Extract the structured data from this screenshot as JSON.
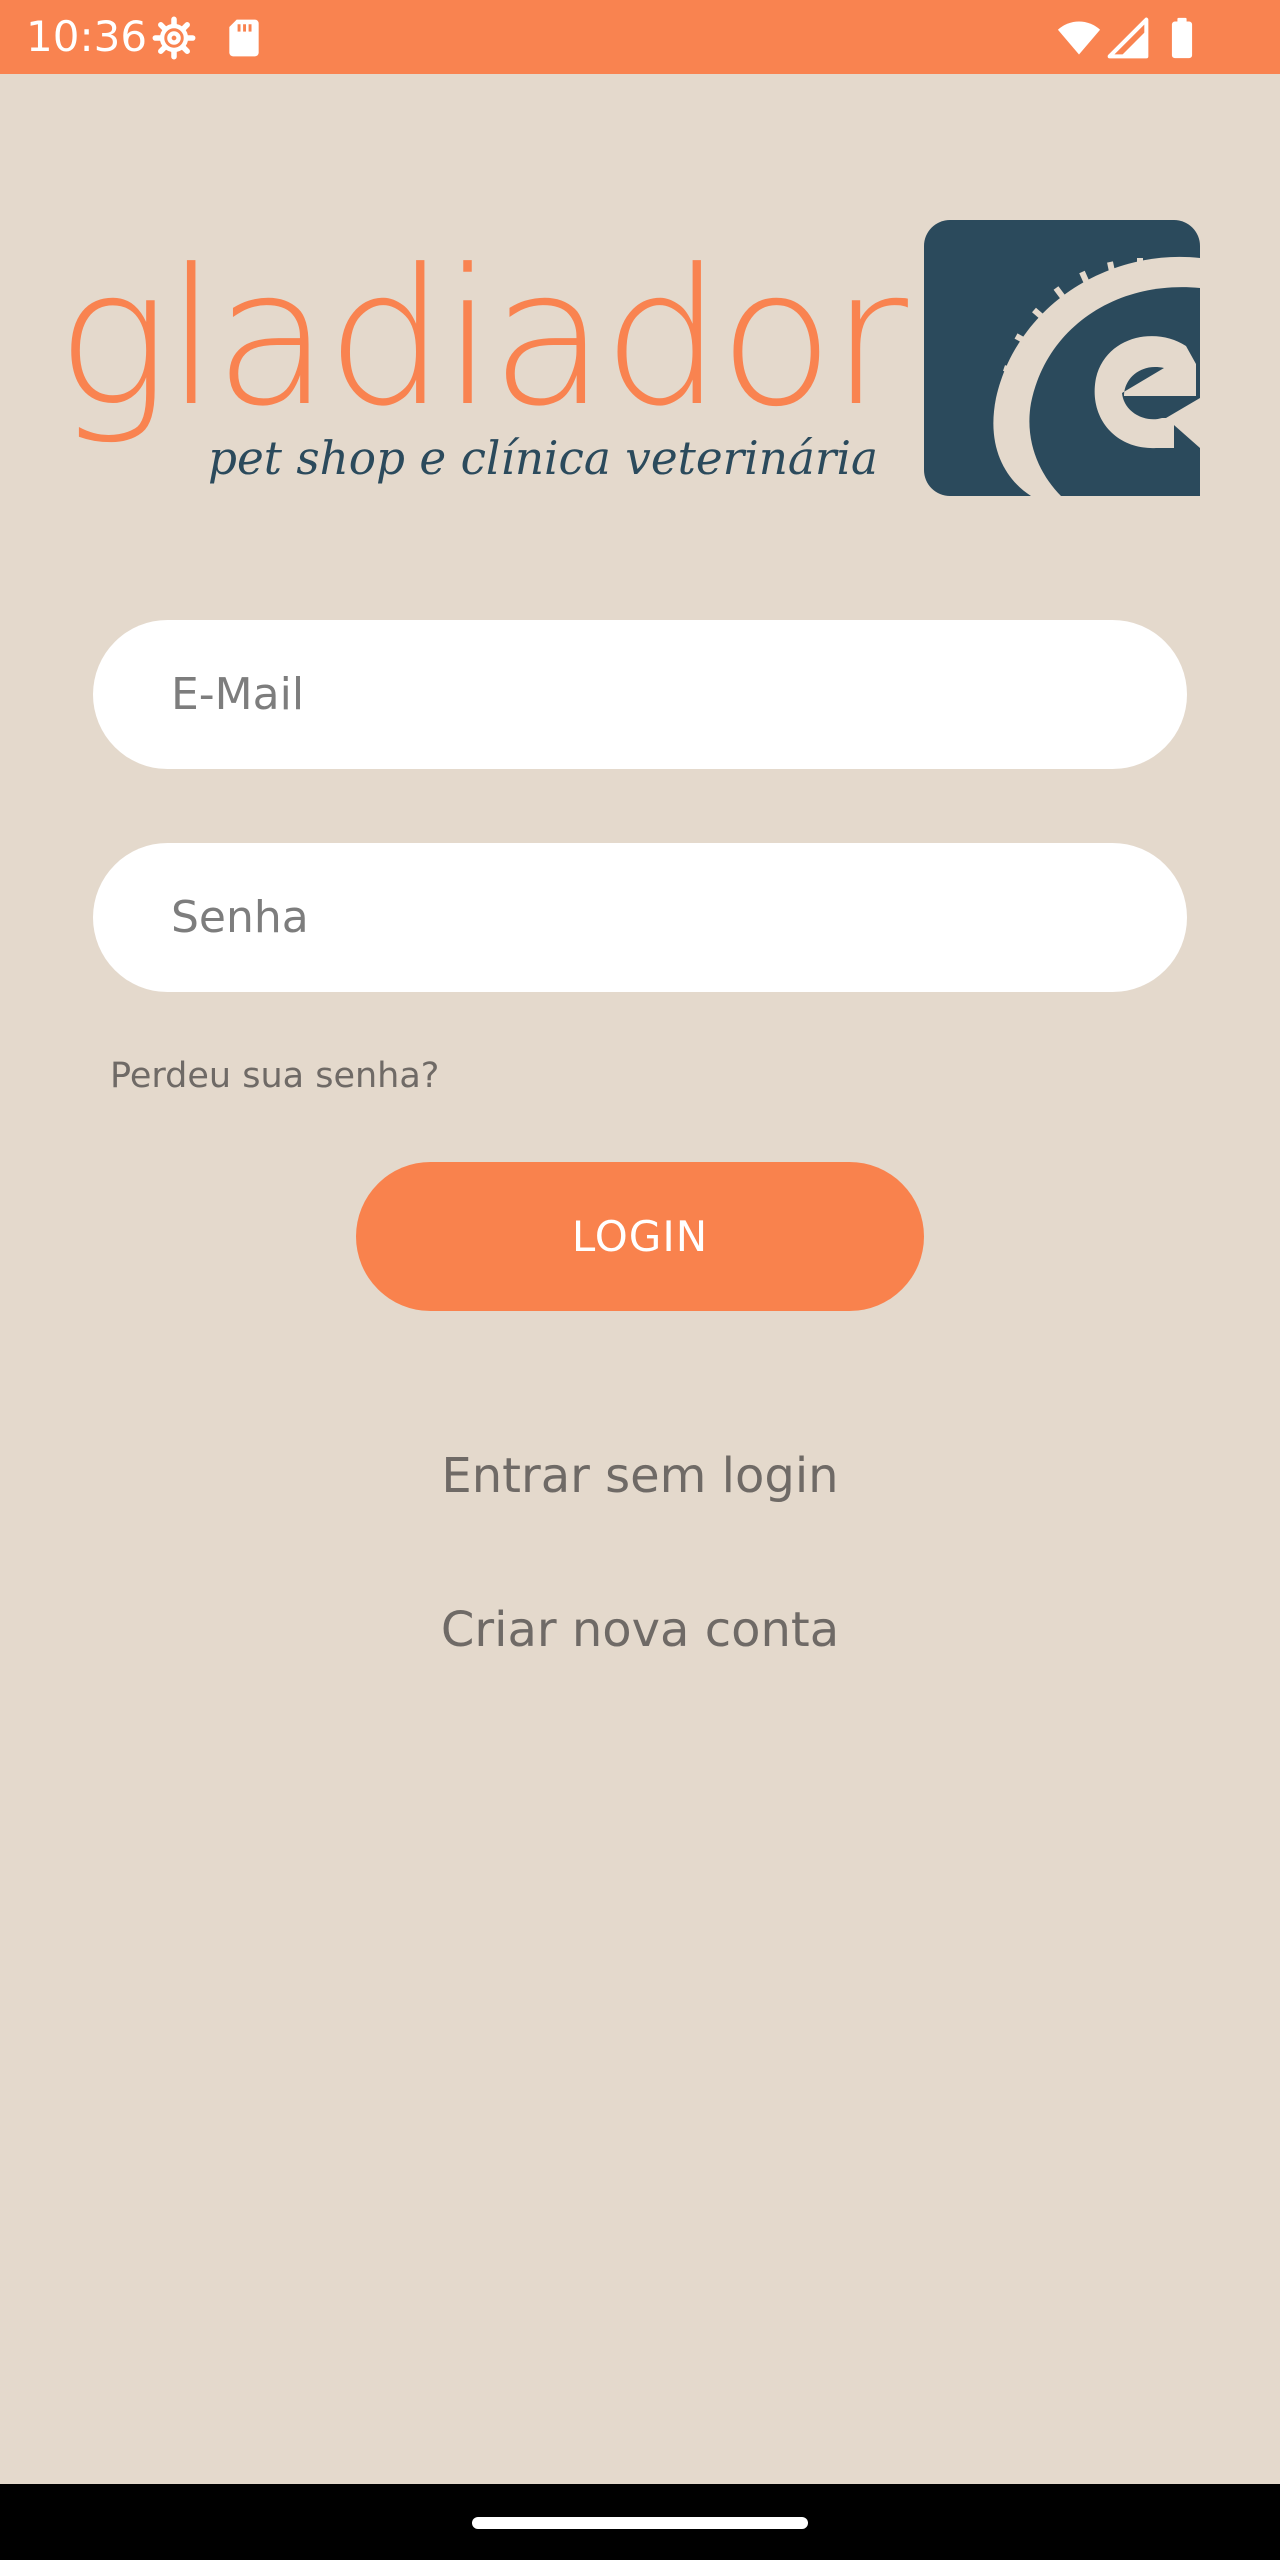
{
  "status_bar": {
    "time": "10:36",
    "icons": [
      "gear-icon",
      "sd-card-icon",
      "wifi-icon",
      "signal-icon",
      "battery-icon"
    ]
  },
  "logo": {
    "brand": "gladiador",
    "tagline": "pet shop e clínica veterinária",
    "colors": {
      "orange": "#f98350",
      "navy": "#2b4a5c"
    }
  },
  "form": {
    "email_placeholder": "E-Mail",
    "password_placeholder": "Senha",
    "forgot_password": "Perdeu sua senha?",
    "login_label": "LOGIN"
  },
  "links": {
    "guest": "Entrar sem login",
    "create_account": "Criar nova conta"
  },
  "colors": {
    "background": "#e4d9cc",
    "accent": "#f98350",
    "text_muted": "#6f6a66"
  }
}
